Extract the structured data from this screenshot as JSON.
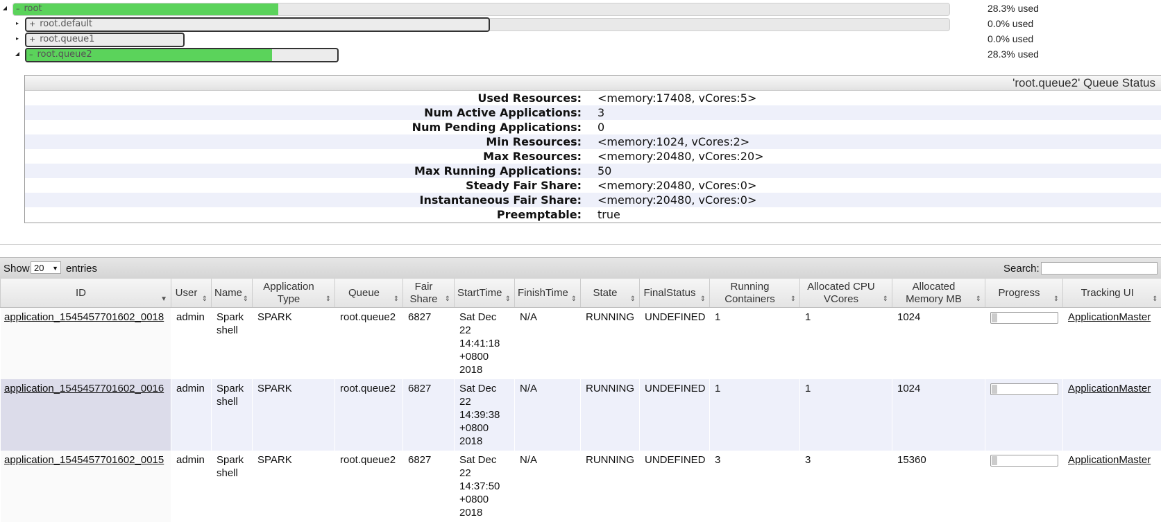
{
  "tree": {
    "root": {
      "name": "root",
      "mark": "–",
      "used": "28.3% used",
      "fill": 0.283
    },
    "children": [
      {
        "name": "root.default",
        "mark": "+",
        "used": "0.0% used",
        "fill": 0.0
      },
      {
        "name": "root.queue1",
        "mark": "+",
        "used": "0.0% used",
        "fill": 0.0
      },
      {
        "name": "root.queue2",
        "mark": "–",
        "used": "28.3% used",
        "fill": 0.283
      }
    ]
  },
  "status": {
    "title": "'root.queue2' Queue Status",
    "rows": [
      {
        "key": "Used Resources:",
        "value": "<memory:17408, vCores:5>"
      },
      {
        "key": "Num Active Applications:",
        "value": "3"
      },
      {
        "key": "Num Pending Applications:",
        "value": "0"
      },
      {
        "key": "Min Resources:",
        "value": "<memory:1024, vCores:2>"
      },
      {
        "key": "Max Resources:",
        "value": "<memory:20480, vCores:20>"
      },
      {
        "key": "Max Running Applications:",
        "value": "50"
      },
      {
        "key": "Steady Fair Share:",
        "value": "<memory:20480, vCores:0>"
      },
      {
        "key": "Instantaneous Fair Share:",
        "value": "<memory:20480, vCores:0>"
      },
      {
        "key": "Preemptable:",
        "value": "true"
      }
    ]
  },
  "toolbar": {
    "show_label": "Show",
    "length_value": "20",
    "entries_label": "entries",
    "search_label": "Search:",
    "search_value": ""
  },
  "table": {
    "columns": [
      "ID",
      "User",
      "Name",
      "Application Type",
      "Queue",
      "Fair Share",
      "StartTime",
      "FinishTime",
      "State",
      "FinalStatus",
      "Running Containers",
      "Allocated CPU VCores",
      "Allocated Memory MB",
      "Progress",
      "Tracking UI"
    ],
    "rows": [
      {
        "id": "application_1545457701602_0018",
        "user": "admin",
        "name": "Spark shell",
        "type": "SPARK",
        "queue": "root.queue2",
        "fair_share": "6827",
        "start": "Sat Dec 22 14:41:18 +0800 2018",
        "finish": "N/A",
        "state": "RUNNING",
        "final": "UNDEFINED",
        "containers": "1",
        "vcores": "1",
        "memory": "1024",
        "progress": 0.0,
        "tracking": "ApplicationMaster"
      },
      {
        "id": "application_1545457701602_0016",
        "user": "admin",
        "name": "Spark shell",
        "type": "SPARK",
        "queue": "root.queue2",
        "fair_share": "6827",
        "start": "Sat Dec 22 14:39:38 +0800 2018",
        "finish": "N/A",
        "state": "RUNNING",
        "final": "UNDEFINED",
        "containers": "1",
        "vcores": "1",
        "memory": "1024",
        "progress": 0.0,
        "tracking": "ApplicationMaster"
      },
      {
        "id": "application_1545457701602_0015",
        "user": "admin",
        "name": "Spark shell",
        "type": "SPARK",
        "queue": "root.queue2",
        "fair_share": "6827",
        "start": "Sat Dec 22 14:37:50 +0800 2018",
        "finish": "N/A",
        "state": "RUNNING",
        "final": "UNDEFINED",
        "containers": "3",
        "vcores": "3",
        "memory": "15360",
        "progress": 0.0,
        "tracking": "ApplicationMaster"
      }
    ]
  },
  "colors": {
    "bar_fill": "#5bd35b",
    "row_alt": "#eef0fa"
  }
}
